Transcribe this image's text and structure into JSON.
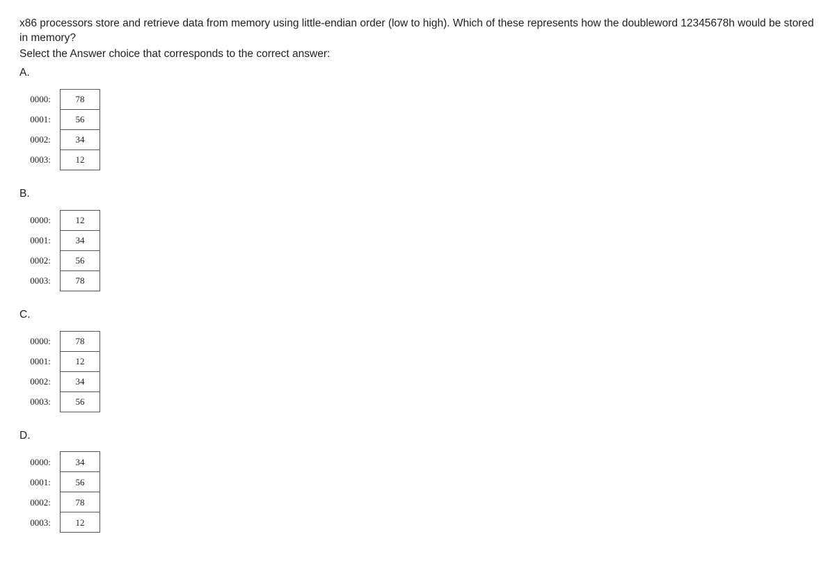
{
  "question": "x86 processors store and retrieve data from memory using little-endian order (low to high). Which of these represents how the doubleword 12345678h would be stored in memory?",
  "select_prompt": "Select the Answer choice that corresponds to the correct answer:",
  "options": [
    {
      "label": "A.",
      "rows": [
        {
          "addr": "0000:",
          "val": "78"
        },
        {
          "addr": "0001:",
          "val": "56"
        },
        {
          "addr": "0002:",
          "val": "34"
        },
        {
          "addr": "0003:",
          "val": "12"
        }
      ]
    },
    {
      "label": "B.",
      "rows": [
        {
          "addr": "0000:",
          "val": "12"
        },
        {
          "addr": "0001:",
          "val": "34"
        },
        {
          "addr": "0002:",
          "val": "56"
        },
        {
          "addr": "0003:",
          "val": "78"
        }
      ]
    },
    {
      "label": "C.",
      "rows": [
        {
          "addr": "0000:",
          "val": "78"
        },
        {
          "addr": "0001:",
          "val": "12"
        },
        {
          "addr": "0002:",
          "val": "34"
        },
        {
          "addr": "0003:",
          "val": "56"
        }
      ]
    },
    {
      "label": "D.",
      "rows": [
        {
          "addr": "0000:",
          "val": "34"
        },
        {
          "addr": "0001:",
          "val": "56"
        },
        {
          "addr": "0002:",
          "val": "78"
        },
        {
          "addr": "0003:",
          "val": "12"
        }
      ]
    }
  ]
}
